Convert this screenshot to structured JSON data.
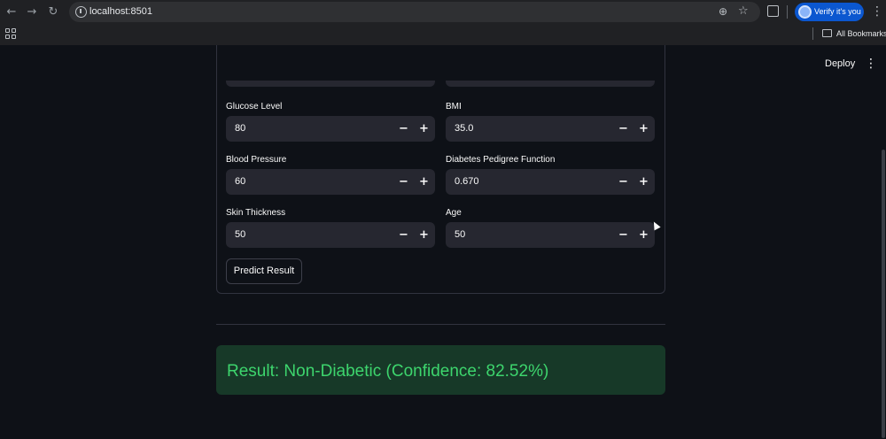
{
  "browser": {
    "url": "localhost:8501",
    "profile_button": "Verify it's you",
    "bookmarks_label": "All Bookmarks",
    "icons": {
      "back": "arrow-left-icon",
      "forward": "arrow-right-icon",
      "reload": "reload-icon",
      "zoom": "zoom-icon",
      "star": "star-icon",
      "extensions": "extensions-icon",
      "menu": "kebab-menu-icon",
      "apps": "apps-grid-icon",
      "folder": "folder-icon"
    }
  },
  "app": {
    "deploy_label": "Deploy",
    "fields": {
      "glucose": {
        "label": "Glucose Level",
        "value": "80"
      },
      "bmi": {
        "label": "BMI",
        "value": "35.0"
      },
      "blood_pressure": {
        "label": "Blood Pressure",
        "value": "60"
      },
      "pedigree": {
        "label": "Diabetes Pedigree Function",
        "value": "0.670"
      },
      "skin": {
        "label": "Skin Thickness",
        "value": "50"
      },
      "age": {
        "label": "Age",
        "value": "50"
      }
    },
    "stepper": {
      "minus": "−",
      "plus": "+"
    },
    "predict_button": "Predict Result",
    "result": "Result: Non-Diabetic (Confidence: 82.52%)",
    "colors": {
      "background": "#0e1117",
      "input": "#262730",
      "success_bg": "#173928",
      "success_text": "#3dd56d"
    }
  }
}
